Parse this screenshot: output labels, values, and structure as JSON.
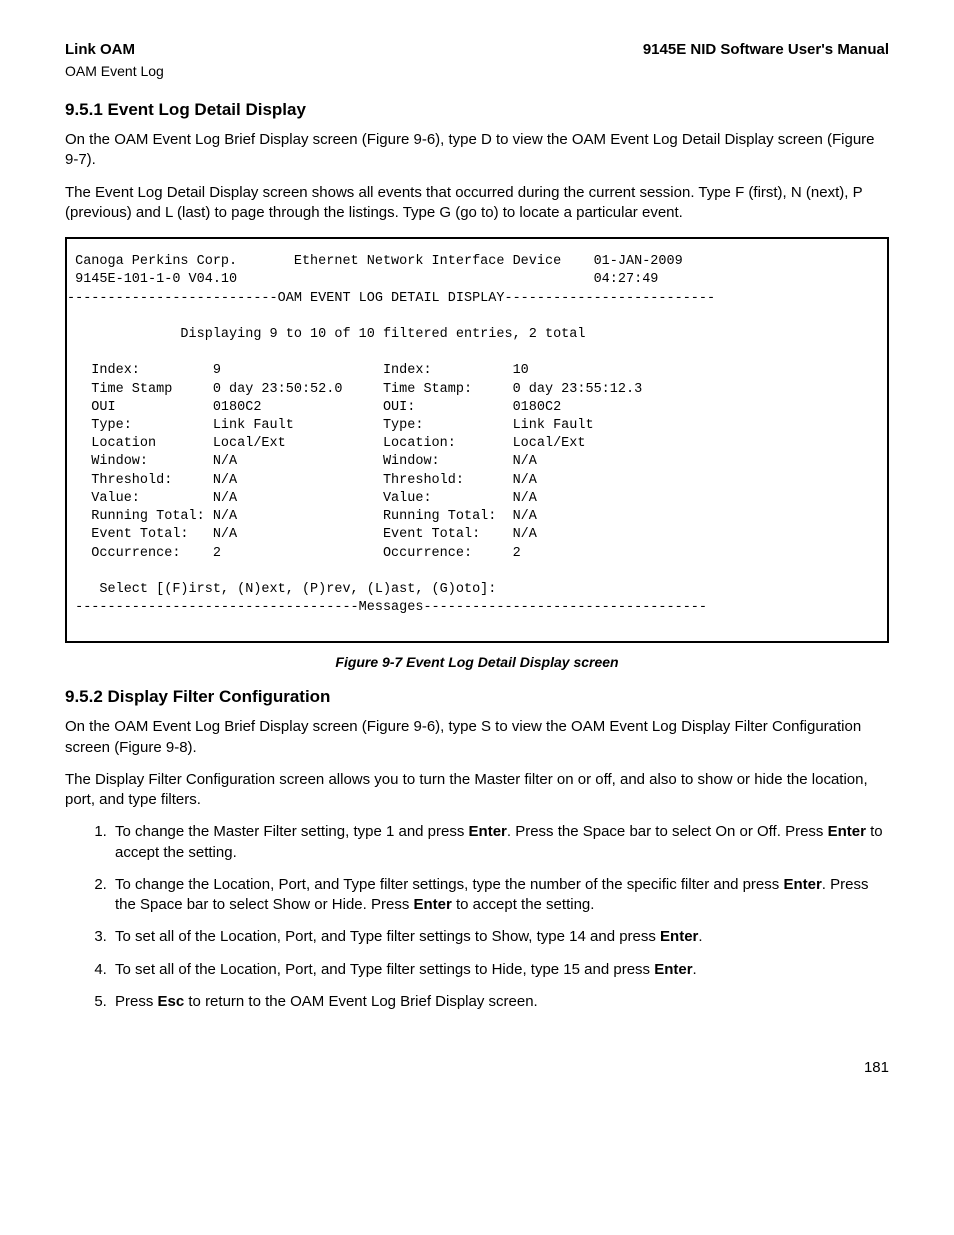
{
  "header": {
    "left_bold": "Link OAM",
    "right_bold": "9145E NID Software User's Manual",
    "left_sub": "OAM Event Log"
  },
  "sec1": {
    "heading": "9.5.1  Event Log Detail Display",
    "p1": "On the OAM Event Log Brief Display screen (Figure 9-6), type D to view the OAM Event Log Detail Display screen (Figure 9-7).",
    "p2": "The Event Log Detail Display screen shows all events that occurred during the current session. Type F (first), N (next), P (previous) and L (last) to page through the listings. Type G (go to) to locate a particular event."
  },
  "terminal": {
    "company": "Canoga Perkins Corp.",
    "device": "Ethernet Network Interface Device",
    "date": "01-JAN-2009",
    "model": "9145E-101-1-0 V04.10",
    "time": "04:27:49",
    "title_line": "--------------------------OAM EVENT LOG DETAIL DISPLAY--------------------------",
    "displaying": "Displaying 9 to 10 of 10 filtered entries, 2 total",
    "left": {
      "index_l": "Index:",
      "index_v": "9",
      "ts_l": "Time Stamp",
      "ts_v": "0 day 23:50:52.0",
      "oui_l": "OUI",
      "oui_v": "0180C2",
      "type_l": "Type:",
      "type_v": "Link Fault",
      "loc_l": "Location",
      "loc_v": "Local/Ext",
      "win_l": "Window:",
      "win_v": "N/A",
      "thr_l": "Threshold:",
      "thr_v": "N/A",
      "val_l": "Value:",
      "val_v": "N/A",
      "rt_l": "Running Total:",
      "rt_v": "N/A",
      "et_l": "Event Total:",
      "et_v": "N/A",
      "occ_l": "Occurrence:",
      "occ_v": "2"
    },
    "right": {
      "index_l": "Index:",
      "index_v": "10",
      "ts_l": "Time Stamp:",
      "ts_v": "0 day 23:55:12.3",
      "oui_l": "OUI:",
      "oui_v": "0180C2",
      "type_l": "Type:",
      "type_v": "Link Fault",
      "loc_l": "Location:",
      "loc_v": "Local/Ext",
      "win_l": "Window:",
      "win_v": "N/A",
      "thr_l": "Threshold:",
      "thr_v": "N/A",
      "val_l": "Value:",
      "val_v": "N/A",
      "rt_l": "Running Total:",
      "rt_v": "N/A",
      "et_l": "Event Total:",
      "et_v": "N/A",
      "occ_l": "Occurrence:",
      "occ_v": "2"
    },
    "prompt": "Select [(F)irst, (N)ext, (P)rev, (L)ast, (G)oto]:",
    "messages_line": "-----------------------------------Messages-----------------------------------"
  },
  "fig_caption": "Figure 9-7  Event Log Detail Display screen",
  "sec2": {
    "heading": "9.5.2  Display Filter Configuration",
    "p1": "On the OAM Event Log Brief Display screen (Figure 9-6), type S to view the OAM Event Log Display Filter Configuration screen (Figure 9-8).",
    "p2": "The Display Filter Configuration screen allows you to turn the Master filter on or off, and also to show or hide the location, port, and type filters.",
    "li1a": "To change the Master Filter setting, type 1 and press ",
    "li1b": ". Press the Space bar to select On or Off. Press ",
    "li1c": " to accept the setting.",
    "li2a": "To change the Location, Port, and Type filter settings, type the number of the specific filter and press ",
    "li2b": ". Press the Space bar to select Show or Hide. Press ",
    "li2c": " to accept the setting.",
    "li3a": "To set all of the Location, Port, and Type filter settings to Show, type 14 and press ",
    "li3b": ".",
    "li4a": "To set all of the Location, Port, and Type filter settings to Hide, type 15 and press ",
    "li4b": ".",
    "li5a": "Press ",
    "li5b": " to return to the OAM Event Log Brief Display screen.",
    "enter": "Enter",
    "esc": "Esc"
  },
  "page_number": "181"
}
